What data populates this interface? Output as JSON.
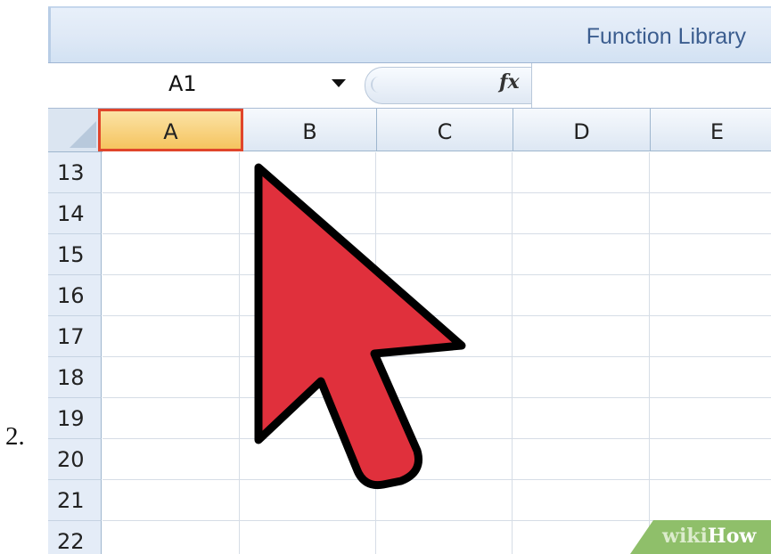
{
  "step": {
    "number": "2."
  },
  "ribbon": {
    "group_label": "Function Library"
  },
  "formula_bar": {
    "name_box_value": "A1",
    "fx_label": "fx",
    "formula_value": ""
  },
  "sheet": {
    "columns": [
      "A",
      "B",
      "C",
      "D",
      "E"
    ],
    "selected_column": "A",
    "rows": [
      "13",
      "14",
      "15",
      "16",
      "17",
      "18",
      "19",
      "20",
      "21",
      "22"
    ]
  },
  "cursor": {
    "icon": "arrow-cursor-icon",
    "fill_color": "#e0303c",
    "outline_color": "#000000"
  },
  "colors": {
    "selection_border": "#e0452b",
    "selected_header_fill": "#f5c45f",
    "header_fill": "#dde7f3",
    "ribbon_text": "#3b5d8f"
  },
  "watermark": {
    "part1": "wiki",
    "part2": "How"
  }
}
